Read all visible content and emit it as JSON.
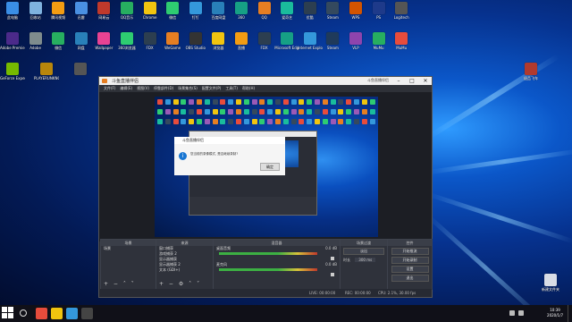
{
  "desktop": {
    "icons_row1": [
      {
        "label": "此电脑",
        "color": "#3a8ee6"
      },
      {
        "label": "回收站",
        "color": "#7fb3e0"
      },
      {
        "label": "腾讯视频",
        "color": "#f39c12"
      },
      {
        "label": "迅雷",
        "color": "#4a90e2"
      },
      {
        "label": "网易云",
        "color": "#c0392b"
      },
      {
        "label": "QQ音乐",
        "color": "#27ae60"
      },
      {
        "label": "Chrome",
        "color": "#f1c40f"
      },
      {
        "label": "微信",
        "color": "#2ecc71"
      },
      {
        "label": "钉钉",
        "color": "#3498db"
      },
      {
        "label": "百度网盘",
        "color": "#2980b9"
      },
      {
        "label": "360",
        "color": "#16a085"
      },
      {
        "label": "QQ",
        "color": "#e67e22"
      },
      {
        "label": "爱奇艺",
        "color": "#1abc9c"
      },
      {
        "label": "优酷",
        "color": "#2c3e50"
      },
      {
        "label": "Steam",
        "color": "#34495e"
      },
      {
        "label": "WPS",
        "color": "#d35400"
      },
      {
        "label": "PS",
        "color": "#1e3a8a"
      },
      {
        "label": "Logitech",
        "color": "#555555"
      }
    ],
    "icons_row2": [
      {
        "label": "Adobe Premiere",
        "color": "#4b2a8a"
      },
      {
        "label": "Adobe",
        "color": "#7f8c8d"
      },
      {
        "label": "微信",
        "color": "#27ae60"
      },
      {
        "label": "网盘",
        "color": "#2980b9"
      },
      {
        "label": "Wallpaper",
        "color": "#e84393"
      },
      {
        "label": "360浏览器",
        "color": "#2ecc71"
      },
      {
        "label": "FDX",
        "color": "#2c3e50"
      },
      {
        "label": "WeGame",
        "color": "#e67e22"
      },
      {
        "label": "OBS Studio",
        "color": "#333333"
      },
      {
        "label": "浏览器",
        "color": "#f1c40f"
      },
      {
        "label": "直播",
        "color": "#f39c12"
      },
      {
        "label": "FDX",
        "color": "#2c3e50"
      },
      {
        "label": "Microsoft Edge",
        "color": "#16a085"
      },
      {
        "label": "Internet Explorer",
        "color": "#3498db"
      },
      {
        "label": "Steam",
        "color": "#1f3a5a"
      },
      {
        "label": "VLP",
        "color": "#8e44ad"
      },
      {
        "label": "MuMu",
        "color": "#27ae60"
      },
      {
        "label": "MuMu",
        "color": "#e74c3c"
      }
    ],
    "icons_row3": [
      {
        "label": "GeForce Experience",
        "color": "#76b900"
      },
      {
        "label": "PLAYERUNKNOWN'S BATTLEGROUNDS",
        "color": "#b8860b"
      },
      {
        "label": "",
        "color": "#555555"
      }
    ],
    "right_icon": {
      "label": "极品飞车",
      "color": "#b03a2e"
    },
    "recycle": {
      "label": "新建文件夹",
      "color": "#d8dde6"
    }
  },
  "obs": {
    "title": "斗鱼直播伴侣",
    "title_right": "斗鱼直播伴侣",
    "menu": [
      "文件(F)",
      "编辑(E)",
      "视图(V)",
      "停靠部件(D)",
      "场景集合(S)",
      "配置文件(P)",
      "工具(T)",
      "帮助(H)"
    ],
    "dialog": {
      "title": "斗鱼直播伴侣",
      "message": "您当前的录像模式, 是否继续录制?",
      "button": "确定"
    },
    "docks": {
      "scenes": {
        "title": "场景",
        "items": [
          "场景"
        ]
      },
      "sources": {
        "title": "来源",
        "items": [
          "窗口捕获",
          "游戏捕获 2",
          "显示器捕获",
          "显示器捕获 2",
          "文本 (GDI+)"
        ]
      },
      "mixer": {
        "title": "混音器",
        "channels": [
          {
            "name": "桌面音频",
            "db": "0.0 dB"
          },
          {
            "name": "麦克风",
            "db": "0.0 dB"
          }
        ]
      },
      "transitions": {
        "title": "场景过渡",
        "type": "淡出",
        "duration_label": "时长",
        "duration": "300 ms"
      },
      "controls": {
        "title": "控件",
        "buttons": [
          "开始推流",
          "开始录制",
          "设置",
          "退出"
        ]
      }
    },
    "status": {
      "live": "LIVE: 00:00:00",
      "rec": "REC: 00:00:00",
      "cpu": "CPU: 2.1%, 30.00 fps"
    }
  },
  "taskbar": {
    "time": "10:39",
    "date": "2020/1/7",
    "apps": [
      {
        "name": "chrome",
        "color": "#e74c3c"
      },
      {
        "name": "explorer",
        "color": "#f1c40f"
      },
      {
        "name": "edge",
        "color": "#3498db"
      },
      {
        "name": "obs",
        "color": "#444444"
      }
    ]
  }
}
